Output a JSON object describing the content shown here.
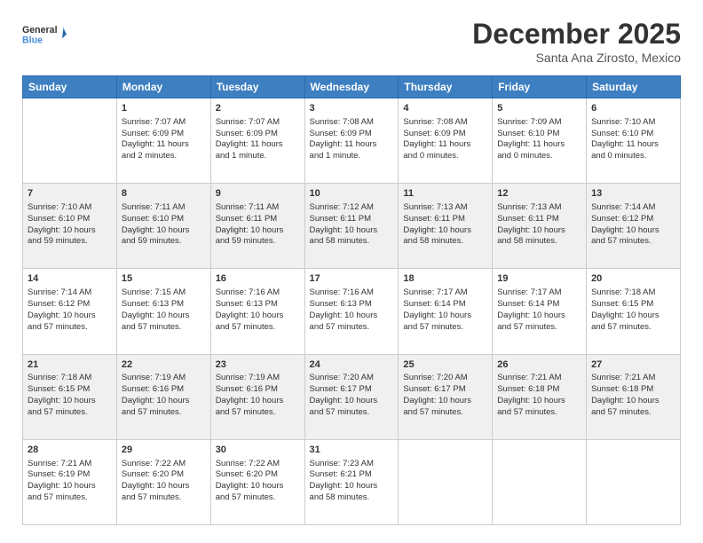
{
  "header": {
    "logo_general": "General",
    "logo_blue": "Blue",
    "month_title": "December 2025",
    "location": "Santa Ana Zirosto, Mexico"
  },
  "days_of_week": [
    "Sunday",
    "Monday",
    "Tuesday",
    "Wednesday",
    "Thursday",
    "Friday",
    "Saturday"
  ],
  "weeks": [
    [
      {
        "day": "",
        "content": ""
      },
      {
        "day": "1",
        "content": "Sunrise: 7:07 AM\nSunset: 6:09 PM\nDaylight: 11 hours\nand 2 minutes."
      },
      {
        "day": "2",
        "content": "Sunrise: 7:07 AM\nSunset: 6:09 PM\nDaylight: 11 hours\nand 1 minute."
      },
      {
        "day": "3",
        "content": "Sunrise: 7:08 AM\nSunset: 6:09 PM\nDaylight: 11 hours\nand 1 minute."
      },
      {
        "day": "4",
        "content": "Sunrise: 7:08 AM\nSunset: 6:09 PM\nDaylight: 11 hours\nand 0 minutes."
      },
      {
        "day": "5",
        "content": "Sunrise: 7:09 AM\nSunset: 6:10 PM\nDaylight: 11 hours\nand 0 minutes."
      },
      {
        "day": "6",
        "content": "Sunrise: 7:10 AM\nSunset: 6:10 PM\nDaylight: 11 hours\nand 0 minutes."
      }
    ],
    [
      {
        "day": "7",
        "content": "Sunrise: 7:10 AM\nSunset: 6:10 PM\nDaylight: 10 hours\nand 59 minutes."
      },
      {
        "day": "8",
        "content": "Sunrise: 7:11 AM\nSunset: 6:10 PM\nDaylight: 10 hours\nand 59 minutes."
      },
      {
        "day": "9",
        "content": "Sunrise: 7:11 AM\nSunset: 6:11 PM\nDaylight: 10 hours\nand 59 minutes."
      },
      {
        "day": "10",
        "content": "Sunrise: 7:12 AM\nSunset: 6:11 PM\nDaylight: 10 hours\nand 58 minutes."
      },
      {
        "day": "11",
        "content": "Sunrise: 7:13 AM\nSunset: 6:11 PM\nDaylight: 10 hours\nand 58 minutes."
      },
      {
        "day": "12",
        "content": "Sunrise: 7:13 AM\nSunset: 6:11 PM\nDaylight: 10 hours\nand 58 minutes."
      },
      {
        "day": "13",
        "content": "Sunrise: 7:14 AM\nSunset: 6:12 PM\nDaylight: 10 hours\nand 57 minutes."
      }
    ],
    [
      {
        "day": "14",
        "content": "Sunrise: 7:14 AM\nSunset: 6:12 PM\nDaylight: 10 hours\nand 57 minutes."
      },
      {
        "day": "15",
        "content": "Sunrise: 7:15 AM\nSunset: 6:13 PM\nDaylight: 10 hours\nand 57 minutes."
      },
      {
        "day": "16",
        "content": "Sunrise: 7:16 AM\nSunset: 6:13 PM\nDaylight: 10 hours\nand 57 minutes."
      },
      {
        "day": "17",
        "content": "Sunrise: 7:16 AM\nSunset: 6:13 PM\nDaylight: 10 hours\nand 57 minutes."
      },
      {
        "day": "18",
        "content": "Sunrise: 7:17 AM\nSunset: 6:14 PM\nDaylight: 10 hours\nand 57 minutes."
      },
      {
        "day": "19",
        "content": "Sunrise: 7:17 AM\nSunset: 6:14 PM\nDaylight: 10 hours\nand 57 minutes."
      },
      {
        "day": "20",
        "content": "Sunrise: 7:18 AM\nSunset: 6:15 PM\nDaylight: 10 hours\nand 57 minutes."
      }
    ],
    [
      {
        "day": "21",
        "content": "Sunrise: 7:18 AM\nSunset: 6:15 PM\nDaylight: 10 hours\nand 57 minutes."
      },
      {
        "day": "22",
        "content": "Sunrise: 7:19 AM\nSunset: 6:16 PM\nDaylight: 10 hours\nand 57 minutes."
      },
      {
        "day": "23",
        "content": "Sunrise: 7:19 AM\nSunset: 6:16 PM\nDaylight: 10 hours\nand 57 minutes."
      },
      {
        "day": "24",
        "content": "Sunrise: 7:20 AM\nSunset: 6:17 PM\nDaylight: 10 hours\nand 57 minutes."
      },
      {
        "day": "25",
        "content": "Sunrise: 7:20 AM\nSunset: 6:17 PM\nDaylight: 10 hours\nand 57 minutes."
      },
      {
        "day": "26",
        "content": "Sunrise: 7:21 AM\nSunset: 6:18 PM\nDaylight: 10 hours\nand 57 minutes."
      },
      {
        "day": "27",
        "content": "Sunrise: 7:21 AM\nSunset: 6:18 PM\nDaylight: 10 hours\nand 57 minutes."
      }
    ],
    [
      {
        "day": "28",
        "content": "Sunrise: 7:21 AM\nSunset: 6:19 PM\nDaylight: 10 hours\nand 57 minutes."
      },
      {
        "day": "29",
        "content": "Sunrise: 7:22 AM\nSunset: 6:20 PM\nDaylight: 10 hours\nand 57 minutes."
      },
      {
        "day": "30",
        "content": "Sunrise: 7:22 AM\nSunset: 6:20 PM\nDaylight: 10 hours\nand 57 minutes."
      },
      {
        "day": "31",
        "content": "Sunrise: 7:23 AM\nSunset: 6:21 PM\nDaylight: 10 hours\nand 58 minutes."
      },
      {
        "day": "",
        "content": ""
      },
      {
        "day": "",
        "content": ""
      },
      {
        "day": "",
        "content": ""
      }
    ]
  ]
}
